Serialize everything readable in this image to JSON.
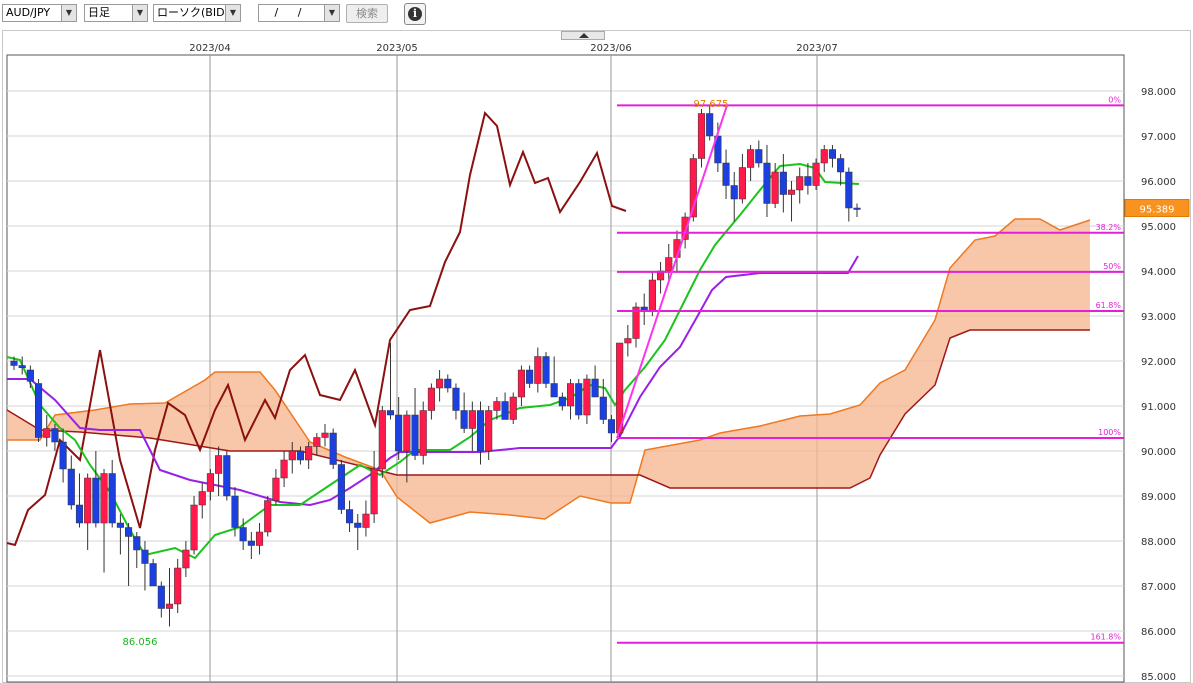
{
  "toolbar": {
    "pair": "AUD/JPY",
    "period": "日足",
    "price_type": "ローソク(BID)",
    "date_value": "/ /",
    "search_label": "検索",
    "info_symbol": "i"
  },
  "chart_data": {
    "type": "candlestick",
    "y_range": [
      85.0,
      98.3
    ],
    "y_ticks": [
      "98.000",
      "97.000",
      "96.000",
      "95.000",
      "94.000",
      "93.000",
      "92.000",
      "91.000",
      "90.000",
      "89.000",
      "88.000",
      "87.000",
      "86.000",
      "85.000"
    ],
    "x_labels": [
      "2023/04",
      "2023/05",
      "2023/06",
      "2023/07"
    ],
    "current_price": "95.389",
    "high_label": "97.675",
    "low_label": "86.056",
    "fib_levels": [
      {
        "label": "0%",
        "value": 97.68
      },
      {
        "label": "38.2%",
        "value": 94.85
      },
      {
        "label": "50%",
        "value": 93.98
      },
      {
        "label": "61.8%",
        "value": 93.11
      },
      {
        "label": "100%",
        "value": 90.29
      },
      {
        "label": "161.8%",
        "value": 85.74
      }
    ],
    "candles": [
      [
        92.0,
        92.1,
        91.8,
        91.9
      ],
      [
        91.9,
        92.1,
        91.7,
        91.85
      ],
      [
        91.8,
        91.9,
        91.4,
        91.55
      ],
      [
        91.5,
        91.6,
        90.2,
        90.3
      ],
      [
        90.3,
        90.8,
        90.1,
        90.5
      ],
      [
        90.5,
        90.6,
        90.0,
        90.2
      ],
      [
        90.2,
        90.5,
        89.3,
        89.6
      ],
      [
        89.6,
        89.9,
        88.7,
        88.8
      ],
      [
        88.8,
        89.5,
        88.3,
        88.4
      ],
      [
        88.4,
        89.5,
        87.8,
        89.4
      ],
      [
        89.4,
        90.0,
        88.3,
        88.4
      ],
      [
        88.4,
        89.6,
        87.3,
        89.5
      ],
      [
        89.5,
        89.8,
        88.3,
        88.4
      ],
      [
        88.4,
        88.6,
        87.7,
        88.3
      ],
      [
        88.3,
        88.4,
        87.0,
        88.1
      ],
      [
        88.1,
        88.2,
        87.4,
        87.8
      ],
      [
        87.8,
        88.0,
        86.9,
        87.5
      ],
      [
        87.5,
        87.6,
        87.1,
        87.0
      ],
      [
        87.0,
        87.1,
        86.3,
        86.5
      ],
      [
        86.5,
        87.4,
        86.1,
        86.6
      ],
      [
        86.6,
        87.6,
        86.4,
        87.4
      ],
      [
        87.4,
        88.0,
        87.2,
        87.8
      ],
      [
        87.8,
        89.0,
        87.7,
        88.8
      ],
      [
        88.8,
        89.3,
        88.5,
        89.1
      ],
      [
        89.1,
        89.6,
        88.9,
        89.5
      ],
      [
        89.5,
        90.1,
        89.0,
        89.9
      ],
      [
        89.9,
        90.0,
        88.9,
        89.0
      ],
      [
        89.0,
        89.2,
        88.1,
        88.3
      ],
      [
        88.3,
        88.5,
        87.8,
        88.0
      ],
      [
        88.0,
        88.2,
        87.6,
        87.9
      ],
      [
        87.9,
        88.4,
        87.7,
        88.2
      ],
      [
        88.2,
        89.0,
        88.1,
        88.9
      ],
      [
        88.9,
        89.6,
        88.8,
        89.4
      ],
      [
        89.4,
        90.0,
        89.2,
        89.8
      ],
      [
        89.8,
        90.2,
        89.5,
        90.0
      ],
      [
        90.0,
        90.1,
        89.7,
        89.8
      ],
      [
        89.8,
        90.2,
        89.6,
        90.1
      ],
      [
        90.1,
        90.4,
        89.9,
        90.3
      ],
      [
        90.3,
        90.6,
        90.1,
        90.4
      ],
      [
        90.4,
        90.5,
        89.6,
        89.7
      ],
      [
        89.7,
        89.8,
        88.6,
        88.7
      ],
      [
        88.7,
        88.9,
        88.2,
        88.4
      ],
      [
        88.4,
        88.6,
        87.8,
        88.3
      ],
      [
        88.3,
        88.9,
        88.1,
        88.6
      ],
      [
        88.6,
        90.0,
        88.4,
        89.6
      ],
      [
        89.6,
        91.0,
        89.4,
        90.9
      ],
      [
        90.9,
        92.4,
        90.7,
        90.8
      ],
      [
        90.8,
        91.2,
        89.8,
        90.0
      ],
      [
        90.0,
        90.9,
        89.3,
        90.8
      ],
      [
        90.8,
        91.4,
        89.8,
        89.9
      ],
      [
        89.9,
        91.1,
        89.7,
        90.9
      ],
      [
        90.9,
        91.5,
        90.7,
        91.4
      ],
      [
        91.4,
        91.8,
        91.1,
        91.6
      ],
      [
        91.6,
        91.7,
        91.3,
        91.4
      ],
      [
        91.4,
        91.5,
        90.7,
        90.9
      ],
      [
        90.9,
        91.3,
        90.4,
        90.5
      ],
      [
        90.5,
        91.1,
        90.0,
        90.9
      ],
      [
        90.9,
        91.1,
        89.7,
        90.0
      ],
      [
        90.0,
        91.0,
        89.8,
        90.9
      ],
      [
        90.9,
        91.2,
        90.7,
        91.1
      ],
      [
        91.1,
        91.3,
        90.8,
        90.7
      ],
      [
        90.7,
        91.3,
        90.6,
        91.2
      ],
      [
        91.2,
        91.9,
        91.0,
        91.8
      ],
      [
        91.8,
        91.9,
        91.4,
        91.5
      ],
      [
        91.5,
        92.3,
        91.3,
        92.1
      ],
      [
        92.1,
        92.2,
        91.4,
        91.5
      ],
      [
        91.5,
        92.1,
        91.3,
        91.2
      ],
      [
        91.2,
        91.3,
        90.9,
        91.0
      ],
      [
        91.0,
        91.6,
        90.7,
        91.5
      ],
      [
        91.5,
        91.6,
        90.7,
        90.8
      ],
      [
        90.8,
        91.7,
        90.6,
        91.6
      ],
      [
        91.6,
        91.9,
        91.3,
        91.2
      ],
      [
        91.2,
        91.6,
        90.6,
        90.7
      ],
      [
        90.7,
        90.8,
        90.2,
        90.4
      ],
      [
        90.4,
        92.4,
        90.3,
        92.4
      ],
      [
        92.4,
        92.8,
        92.1,
        92.5
      ],
      [
        92.5,
        93.3,
        92.3,
        93.2
      ],
      [
        93.2,
        93.5,
        92.8,
        93.1
      ],
      [
        93.1,
        94.0,
        93.0,
        93.8
      ],
      [
        93.8,
        94.2,
        93.5,
        94.0
      ],
      [
        94.0,
        94.6,
        93.8,
        94.3
      ],
      [
        94.3,
        94.9,
        94.0,
        94.7
      ],
      [
        94.7,
        95.3,
        94.5,
        95.2
      ],
      [
        95.2,
        96.6,
        95.1,
        96.5
      ],
      [
        96.5,
        97.6,
        96.3,
        97.5
      ],
      [
        97.5,
        97.7,
        96.9,
        97.0
      ],
      [
        97.0,
        97.3,
        96.2,
        96.4
      ],
      [
        96.4,
        96.7,
        95.6,
        95.9
      ],
      [
        95.9,
        96.2,
        95.1,
        95.6
      ],
      [
        95.6,
        96.6,
        95.5,
        96.3
      ],
      [
        96.3,
        96.8,
        96.0,
        96.7
      ],
      [
        96.7,
        96.9,
        96.3,
        96.4
      ],
      [
        96.4,
        96.8,
        95.2,
        95.5
      ],
      [
        95.5,
        96.4,
        95.4,
        96.2
      ],
      [
        96.2,
        96.6,
        95.3,
        95.7
      ],
      [
        95.7,
        96.0,
        95.1,
        95.8
      ],
      [
        95.8,
        96.3,
        95.5,
        96.1
      ],
      [
        96.1,
        96.4,
        95.7,
        95.9
      ],
      [
        95.9,
        96.5,
        95.8,
        96.4
      ],
      [
        96.4,
        96.8,
        96.2,
        96.7
      ],
      [
        96.7,
        96.8,
        96.3,
        96.5
      ],
      [
        96.5,
        96.6,
        95.9,
        96.2
      ],
      [
        96.2,
        96.3,
        95.1,
        95.4
      ],
      [
        95.4,
        95.5,
        95.2,
        95.389
      ]
    ]
  }
}
